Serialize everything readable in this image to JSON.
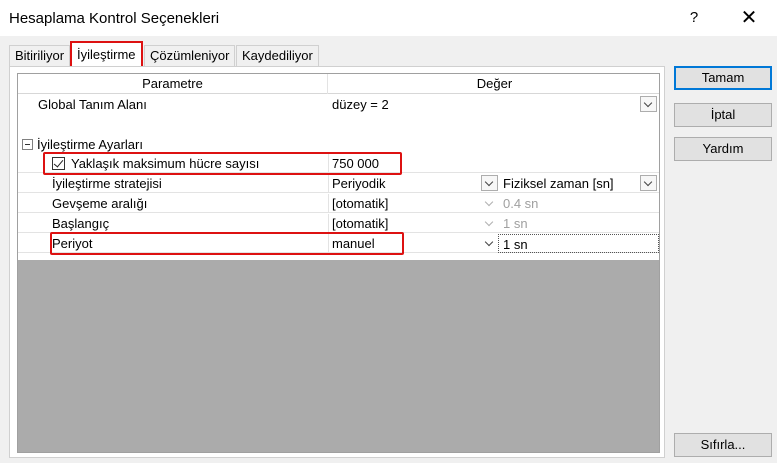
{
  "window": {
    "title": "Hesaplama Kontrol Seçenekleri",
    "help_label": "?",
    "close_label": "✕"
  },
  "tabs": [
    {
      "label": "Bitiriliyor"
    },
    {
      "label": "İyileştirme"
    },
    {
      "label": "Çözümleniyor"
    },
    {
      "label": "Kaydediliyor"
    }
  ],
  "grid": {
    "header": {
      "parameter": "Parametre",
      "value": "Değer"
    },
    "global": {
      "label": "Global Tanım Alanı",
      "value": "düzey = 2"
    },
    "section": {
      "label": "İyileştirme Ayarları"
    },
    "rows": [
      {
        "label": "Yaklaşık maksimum hücre sayısı",
        "value": "750 000"
      },
      {
        "label": "İyileştirme stratejisi",
        "value": "Periyodik",
        "extra": "Fiziksel zaman [sn]"
      },
      {
        "label": "Gevşeme aralığı",
        "value": "[otomatik]",
        "extra": "0.4 sn"
      },
      {
        "label": "Başlangıç",
        "value": "[otomatik]",
        "extra": "1 sn"
      },
      {
        "label": "Periyot",
        "value": "manuel",
        "extra": "1 sn"
      }
    ]
  },
  "buttons": {
    "ok": "Tamam",
    "cancel": "İptal",
    "help": "Yardım",
    "reset": "Sıfırla..."
  }
}
